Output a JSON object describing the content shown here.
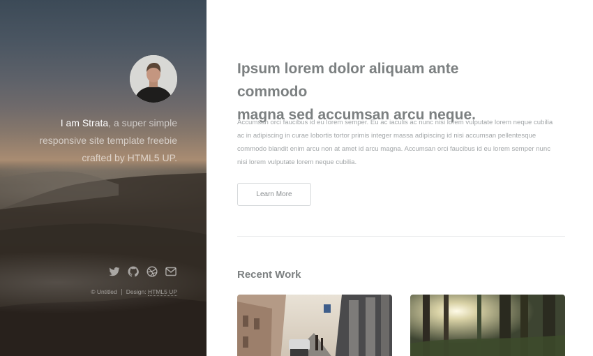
{
  "header": {
    "intro_name": "I am Strata",
    "intro_line1_rest": ", a super simple",
    "intro_line2": "responsive site template freebie",
    "intro_line3": "crafted by HTML5 UP."
  },
  "social_icons": [
    "twitter-icon",
    "github-icon",
    "dribbble-icon",
    "envelope-icon"
  ],
  "footer": {
    "copyright": "© Untitled",
    "design_label": "Design:",
    "design_link": "HTML5 UP"
  },
  "main": {
    "headline_line1": "Ipsum lorem dolor aliquam ante commodo",
    "headline_line2": "magna sed accumsan arcu neque.",
    "body": "Accumsan orci faucibus id eu lorem semper. Eu ac iaculis ac nunc nisi lorem vulputate lorem neque cubilia ac in adipiscing in curae lobortis tortor primis integer massa adipiscing id nisi accumsan pellentesque commodo blandit enim arcu non at amet id arcu magna. Accumsan orci faucibus id eu lorem semper nunc nisi lorem vulputate lorem neque cubilia.",
    "button_label": "Learn More",
    "section_title": "Recent Work"
  },
  "colors": {
    "headline": "#7c8081",
    "body": "#a2a6a8",
    "button_border": "#d5d8da"
  }
}
